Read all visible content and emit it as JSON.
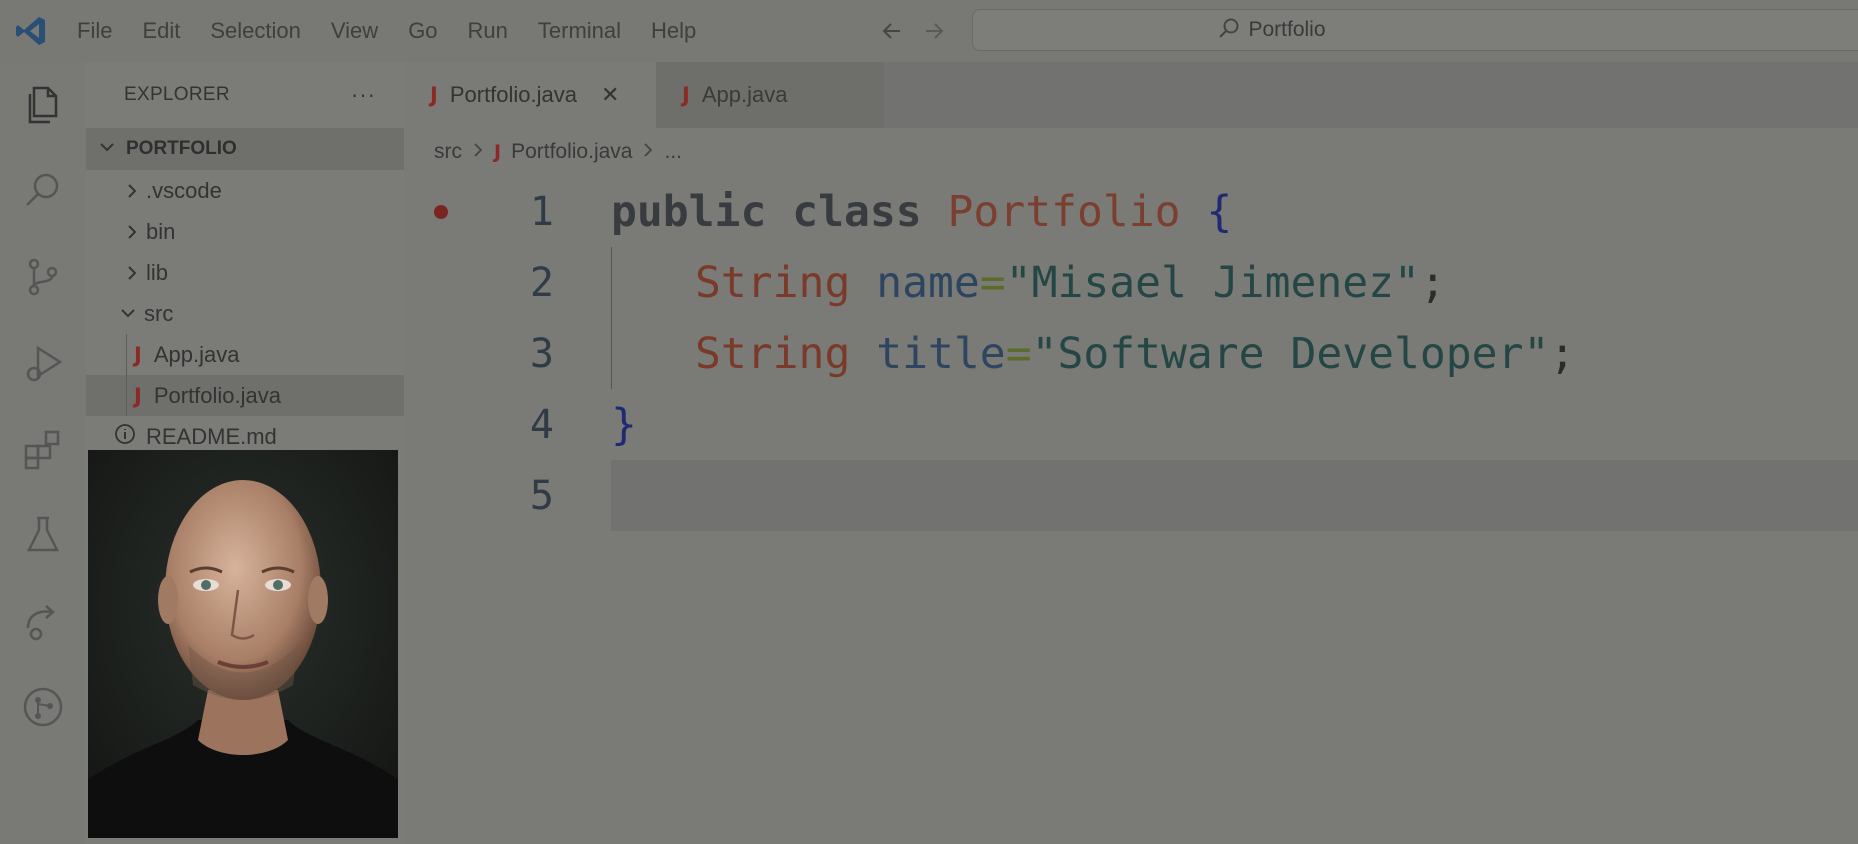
{
  "menu": {
    "items": [
      "File",
      "Edit",
      "Selection",
      "View",
      "Go",
      "Run",
      "Terminal",
      "Help"
    ]
  },
  "command_center": {
    "text": "Portfolio"
  },
  "activity_bar": {
    "icons": [
      "explorer-icon",
      "search-icon",
      "source-control-icon",
      "run-debug-icon",
      "extensions-icon",
      "testing-icon",
      "remote-explorer-icon",
      "git-graph-icon"
    ]
  },
  "sidebar": {
    "title": "EXPLORER",
    "more": "···",
    "folder": "PORTFOLIO",
    "tree": [
      {
        "label": ".vscode",
        "kind": "folder-collapsed"
      },
      {
        "label": "bin",
        "kind": "folder-collapsed"
      },
      {
        "label": "lib",
        "kind": "folder-collapsed"
      },
      {
        "label": "src",
        "kind": "folder-expanded"
      },
      {
        "label": "App.java",
        "kind": "java"
      },
      {
        "label": "Portfolio.java",
        "kind": "java",
        "selected": true
      },
      {
        "label": "README.md",
        "kind": "info"
      }
    ]
  },
  "editor": {
    "tabs": [
      {
        "label": "Portfolio.java",
        "active": true
      },
      {
        "label": "App.java",
        "active": false
      }
    ],
    "breadcrumb": {
      "folder": "src",
      "file": "Portfolio.java",
      "more": "..."
    },
    "lines": [
      {
        "n": "1"
      },
      {
        "n": "2"
      },
      {
        "n": "3"
      },
      {
        "n": "4"
      },
      {
        "n": "5"
      }
    ],
    "code": {
      "l1_kw": "public class ",
      "l1_cls": "Portfolio",
      "l1_brace": " {",
      "l2_type": "String",
      "l2_ident": " name",
      "l2_op": "=",
      "l2_str": "\"Misael Jimenez\"",
      "l2_end": ";",
      "l3_type": "String",
      "l3_ident": " title",
      "l3_op": "=",
      "l3_str": "\"Software Developer\"",
      "l3_end": ";",
      "l4_brace": "}"
    },
    "java_icon_letter": "J"
  },
  "colors": {
    "accent": "#8b2a25",
    "breakpoint": "#7a2522",
    "background": "#7a7a77"
  }
}
